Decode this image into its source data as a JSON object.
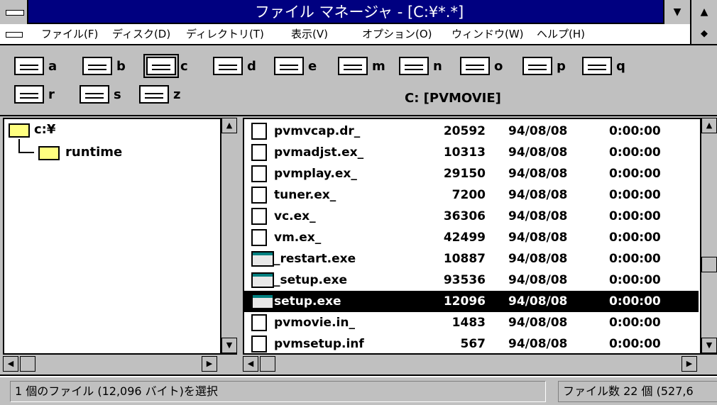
{
  "window": {
    "title": "ファイル マネージャ - [C:¥*.*]",
    "minimize_glyph": "▼",
    "maximize_glyph": "▲",
    "restore_glyph": "◆"
  },
  "menu": {
    "items": [
      "ファイル(F)",
      "ディスク(D)",
      "ディレクトリ(T)",
      "表示(V)",
      "オプション(O)",
      "ウィンドウ(W)",
      "ヘルプ(H)"
    ]
  },
  "drives": [
    "a",
    "b",
    "c",
    "d",
    "e",
    "m",
    "n",
    "o",
    "p",
    "q",
    "r",
    "s",
    "z"
  ],
  "selected_drive": "c",
  "path_label": "C: [PVMOVIE]",
  "tree": {
    "root": "c:¥",
    "children": [
      "runtime"
    ]
  },
  "files": [
    {
      "name": "pvmvcap.dr_",
      "size": "20592",
      "date": "94/08/08",
      "time": "0:00:00",
      "icon": "file-icon"
    },
    {
      "name": "pvmadjst.ex_",
      "size": "10313",
      "date": "94/08/08",
      "time": "0:00:00",
      "icon": "file-icon"
    },
    {
      "name": "pvmplay.ex_",
      "size": "29150",
      "date": "94/08/08",
      "time": "0:00:00",
      "icon": "file-icon"
    },
    {
      "name": "tuner.ex_",
      "size": "7200",
      "date": "94/08/08",
      "time": "0:00:00",
      "icon": "file-icon"
    },
    {
      "name": "vc.ex_",
      "size": "36306",
      "date": "94/08/08",
      "time": "0:00:00",
      "icon": "file-icon"
    },
    {
      "name": "vm.ex_",
      "size": "42499",
      "date": "94/08/08",
      "time": "0:00:00",
      "icon": "file-icon"
    },
    {
      "name": "_restart.exe",
      "size": "10887",
      "date": "94/08/08",
      "time": "0:00:00",
      "icon": "program-icon"
    },
    {
      "name": "_setup.exe",
      "size": "93536",
      "date": "94/08/08",
      "time": "0:00:00",
      "icon": "program-icon"
    },
    {
      "name": "setup.exe",
      "size": "12096",
      "date": "94/08/08",
      "time": "0:00:00",
      "icon": "program-icon",
      "selected": true
    },
    {
      "name": "pvmovie.in_",
      "size": "1483",
      "date": "94/08/08",
      "time": "0:00:00",
      "icon": "file-icon"
    },
    {
      "name": "pvmsetup.inf",
      "size": "567",
      "date": "94/08/08",
      "time": "0:00:00",
      "icon": "file-icon"
    }
  ],
  "status": {
    "left": "1 個のファイル (12,096 バイト)を選択",
    "right": "ファイル数 22 個 (527,6"
  }
}
